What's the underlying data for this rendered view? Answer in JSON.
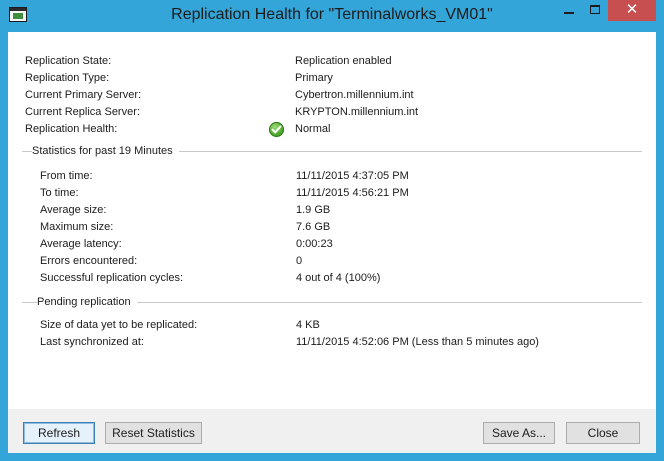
{
  "window": {
    "title": "Replication Health for \"Terminalworks_VM01\"",
    "close_glyph": "✕",
    "icons": {
      "app": "hyper-v-manager-icon",
      "minimize": "minimize-icon",
      "maximize": "maximize-icon",
      "close": "close-icon"
    }
  },
  "summary": {
    "rows": [
      {
        "label": "Replication State:",
        "value": "Replication enabled"
      },
      {
        "label": "Replication Type:",
        "value": "Primary"
      },
      {
        "label": "Current Primary Server:",
        "value": "Cybertron.millennium.int"
      },
      {
        "label": "Current Replica Server:",
        "value": "KRYPTON.millennium.int"
      },
      {
        "label": "Replication Health:",
        "value": "Normal",
        "icon": "green-checkmark-icon"
      }
    ]
  },
  "statistics": {
    "group_title": "Statistics for past 19 Minutes",
    "rows": [
      {
        "label": "From time:",
        "value": "11/11/2015 4:37:05 PM"
      },
      {
        "label": "To time:",
        "value": "11/11/2015 4:56:21 PM"
      },
      {
        "label": "Average size:",
        "value": "1.9 GB"
      },
      {
        "label": "Maximum size:",
        "value": "7.6 GB"
      },
      {
        "label": "Average latency:",
        "value": "0:00:23"
      },
      {
        "label": "Errors encountered:",
        "value": "0"
      },
      {
        "label": "Successful replication cycles:",
        "value": "4 out of 4 (100%)"
      }
    ]
  },
  "pending": {
    "group_title": "Pending replication",
    "rows": [
      {
        "label": "Size of data yet to be replicated:",
        "value": "4 KB"
      },
      {
        "label": "Last synchronized at:",
        "value": "11/11/2015 4:52:06 PM (Less than 5 minutes ago)"
      }
    ]
  },
  "buttons": {
    "refresh": "Refresh",
    "reset_statistics": "Reset Statistics",
    "save_as": "Save As...",
    "close": "Close"
  },
  "colors": {
    "titlebar": "#33a5d8",
    "close_button": "#c74f4f",
    "footer": "#f0f0f0",
    "health_ok": "#4aa52a"
  }
}
